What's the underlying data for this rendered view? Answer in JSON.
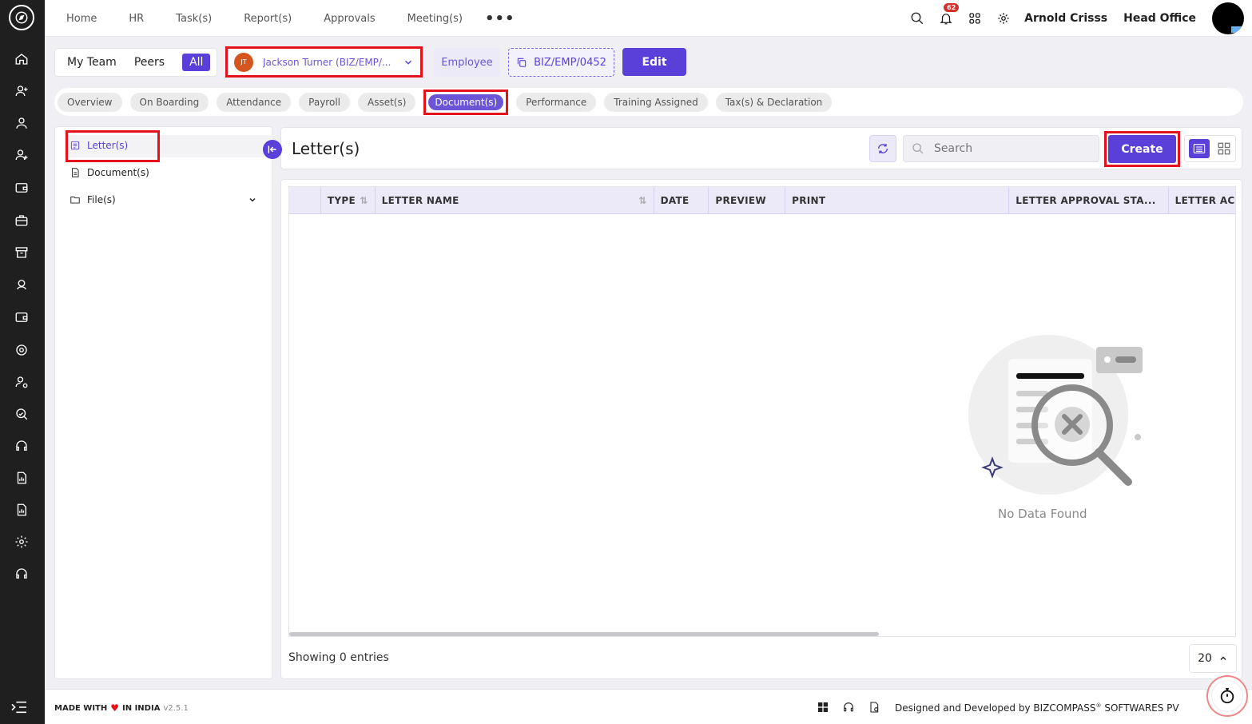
{
  "topnav": {
    "menu": [
      "Home",
      "HR",
      "Task(s)",
      "Report(s)",
      "Approvals",
      "Meeting(s)"
    ],
    "more_label": "•••",
    "notification_count": "62",
    "user_name": "Arnold Crisss",
    "office": "Head Office"
  },
  "sidebar": {
    "icons": [
      "home-icon",
      "add-user-icon",
      "user-icon",
      "add-user-icon",
      "wallet-icon",
      "briefcase-icon",
      "archive-icon",
      "support-icon",
      "wallet-icon",
      "target-icon",
      "user-settings-icon",
      "chart-search-icon",
      "headset-icon",
      "report-icon",
      "report-icon",
      "gear-icon",
      "headset-icon"
    ]
  },
  "filters": {
    "team": [
      "My Team",
      "Peers",
      "All"
    ],
    "employee_initials": "JT",
    "employee_name": "Jackson Turner (BIZ/EMP/...",
    "employee_tag": "Employee",
    "employee_code": "BIZ/EMP/0452",
    "edit_label": "Edit"
  },
  "tabs": [
    "Overview",
    "On Boarding",
    "Attendance",
    "Payroll",
    "Asset(s)",
    "Document(s)",
    "Performance",
    "Training Assigned",
    "Tax(s) & Declaration"
  ],
  "active_tab": "Document(s)",
  "doc_menu": {
    "letters": "Letter(s)",
    "documents": "Document(s)",
    "files": "File(s)"
  },
  "main": {
    "title": "Letter(s)",
    "search_placeholder": "Search",
    "create_label": "Create",
    "columns": [
      "TYPE",
      "LETTER NAME",
      "DATE",
      "PREVIEW",
      "PRINT",
      "LETTER APPROVAL STA...",
      "LETTER AC"
    ],
    "empty_text": "No Data Found",
    "showing": "Showing 0 entries",
    "page_size": "20"
  },
  "footer": {
    "made_with": "MADE WITH",
    "in_india": "IN INDIA",
    "version": "v2.5.1",
    "designed": "Designed and Developed by",
    "company": "BIZCOMPASS",
    "company_rest": "SOFTWARES PV"
  },
  "colors": {
    "primary": "#5a3fd8",
    "highlight": "#e5121e",
    "sidebar_bg": "#1f1f1f"
  }
}
